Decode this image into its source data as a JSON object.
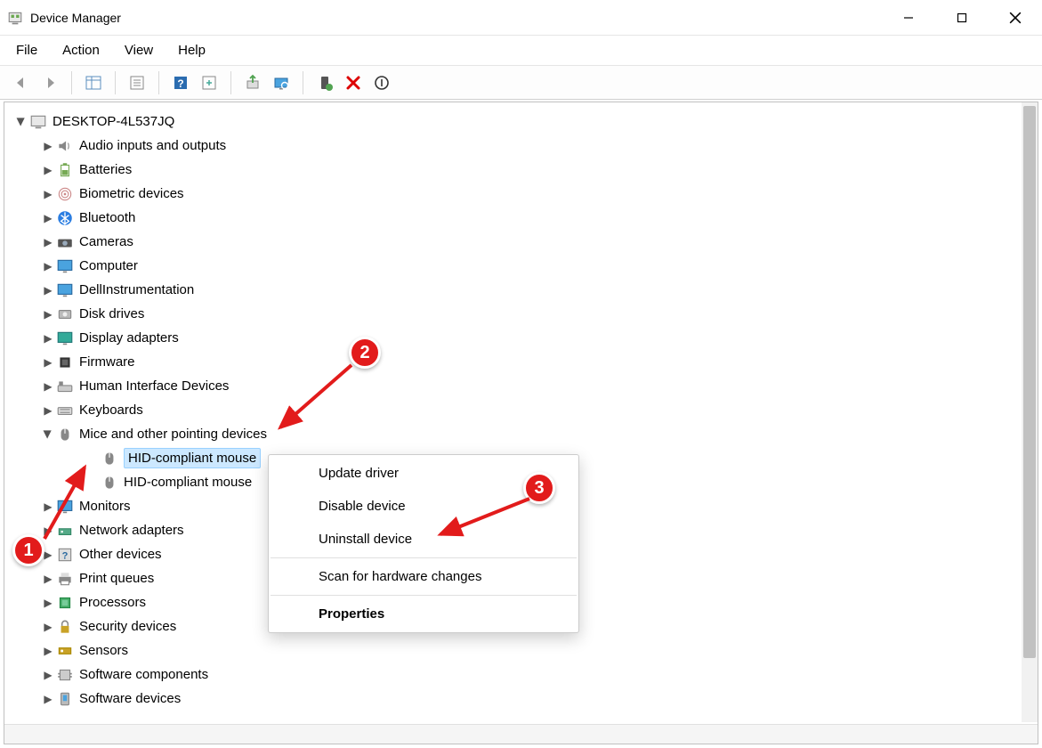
{
  "app": {
    "title": "Device Manager"
  },
  "menubar": {
    "file": "File",
    "action": "Action",
    "view": "View",
    "help": "Help"
  },
  "tree": {
    "root": "DESKTOP-4L537JQ",
    "c0": "Audio inputs and outputs",
    "c1": "Batteries",
    "c2": "Biometric devices",
    "c3": "Bluetooth",
    "c4": "Cameras",
    "c5": "Computer",
    "c6": "DellInstrumentation",
    "c7": "Disk drives",
    "c8": "Display adapters",
    "c9": "Firmware",
    "c10": "Human Interface Devices",
    "c11": "Keyboards",
    "c12": "Mice and other pointing devices",
    "c12a": "HID-compliant mouse",
    "c12b": "HID-compliant mouse",
    "c13": "Monitors",
    "c14": "Network adapters",
    "c15": "Other devices",
    "c16": "Print queues",
    "c17": "Processors",
    "c18": "Security devices",
    "c19": "Sensors",
    "c20": "Software components",
    "c21": "Software devices"
  },
  "context_menu": {
    "update": "Update driver",
    "disable": "Disable device",
    "uninstall": "Uninstall device",
    "scan": "Scan for hardware changes",
    "properties": "Properties"
  },
  "annotations": {
    "m1": "1",
    "m2": "2",
    "m3": "3"
  }
}
